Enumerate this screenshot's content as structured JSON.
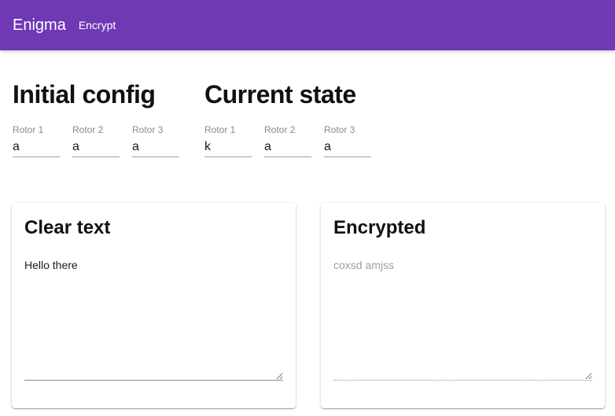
{
  "colors": {
    "appbar_bg": "#6f38b4",
    "appbar_text": "#ffffff"
  },
  "appbar": {
    "title": "Enigma",
    "nav_link": "Encrypt"
  },
  "initial_config": {
    "heading": "Initial config",
    "rotors": [
      {
        "label": "Rotor 1",
        "value": "a"
      },
      {
        "label": "Rotor 2",
        "value": "a"
      },
      {
        "label": "Rotor 3",
        "value": "a"
      }
    ]
  },
  "current_state": {
    "heading": "Current state",
    "rotors": [
      {
        "label": "Rotor 1",
        "value": "k"
      },
      {
        "label": "Rotor 2",
        "value": "a"
      },
      {
        "label": "Rotor 3",
        "value": "a"
      }
    ]
  },
  "clear_text_card": {
    "title": "Clear text",
    "value": "Hello there"
  },
  "encrypted_card": {
    "title": "Encrypted",
    "value": "coxsd amjss"
  }
}
